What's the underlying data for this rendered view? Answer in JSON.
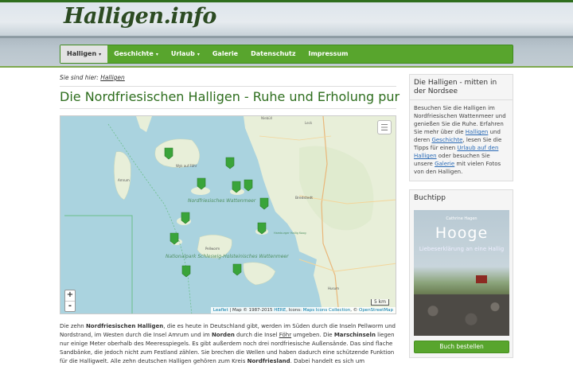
{
  "site": {
    "logo": "Halligen.info"
  },
  "nav": {
    "items": [
      {
        "label": "Halligen",
        "caret": "▾",
        "active": true
      },
      {
        "label": "Geschichte",
        "caret": "▾"
      },
      {
        "label": "Urlaub",
        "caret": "▾"
      },
      {
        "label": "Galerie"
      },
      {
        "label": "Datenschutz"
      },
      {
        "label": "Impressum"
      }
    ]
  },
  "breadcrumb": {
    "prefix": "Sie sind hier:",
    "link": "Halligen"
  },
  "page": {
    "title": "Die Nordfriesischen Halligen - Ruhe und Erholung pur"
  },
  "map": {
    "zoom_in": "+",
    "zoom_out": "-",
    "scale": "5 km",
    "labels": {
      "niebuell": "Niebüll",
      "leck": "Leck",
      "wyk": "Wyk auf Föhr",
      "amrum": "Amrum",
      "wattenmeer": "Nordfriesisches Wattenmeer",
      "bredstedt": "Bredstedt",
      "hamburger_koog": "Hamburger Hallig Koog",
      "pellworm": "Pellworm",
      "nationalpark": "Nationalpark Schleswig-Holsteinisches Wattenmeer",
      "husum": "Husum"
    },
    "attribution": {
      "leaflet": "Leaflet",
      "middle": "| Map © 1987-2015",
      "here": "HERE",
      "icons_prefix": ", Icons:",
      "icons": "Maps Icons Collection",
      "osm_prefix": ", ©",
      "osm": "OpenStreetMap"
    },
    "colors": {
      "water": "#aad3df",
      "land": "#e8efd9",
      "marker": "#3aa43a"
    }
  },
  "intro": {
    "t1": "Die zehn ",
    "b1": "Nordfriesischen Halligen",
    "t2": ", die es heute in Deutschland gibt, werden im Süden durch die Inseln Pellworm und Nordstrand, im Westen durch die Insel Amrum und im ",
    "b2": "Norden",
    "t3": " durch die Insel ",
    "link1": "Föhr",
    "t4": " umgeben. Die ",
    "b3": "Marschinseln",
    "t5": " liegen nur einige Meter oberhalb des Meeresspiegels. Es gibt außerdem noch drei nordfriesische Außensände. Das sind flache Sandbänke, die jedoch nicht zum Festland zählen. Sie brechen die Wellen und haben dadurch eine schützende Funktion für die Halligwelt. Alle zehn deutschen Halligen gehören zum Kreis ",
    "b4": "Nordfriesland",
    "t6": ". Dabei handelt es sich um"
  },
  "sidebar": {
    "box1": {
      "title": "Die Halligen - mitten in der Nordsee",
      "p1": "Besuchen Sie die Halligen im Nordfriesischen Wattenmeer und genießen Sie die Ruhe. Erfahren Sie mehr über die ",
      "l1": "Halligen",
      "p2": " und deren ",
      "l2": "Geschichte",
      "p3": ", lesen Sie die Tipps für einen ",
      "l3": "Urlaub auf den Halligen",
      "p4": " oder besuchen Sie unsere ",
      "l4": "Galerie",
      "p5": " mit vielen Fotos von den Halligen."
    },
    "box2": {
      "title": "Buchtipp",
      "book_author": "Cathrine Hagen",
      "book_title": "Hooge",
      "book_subtitle": "Liebeserklärung an eine Hallig",
      "button": "Buch bestellen"
    }
  }
}
